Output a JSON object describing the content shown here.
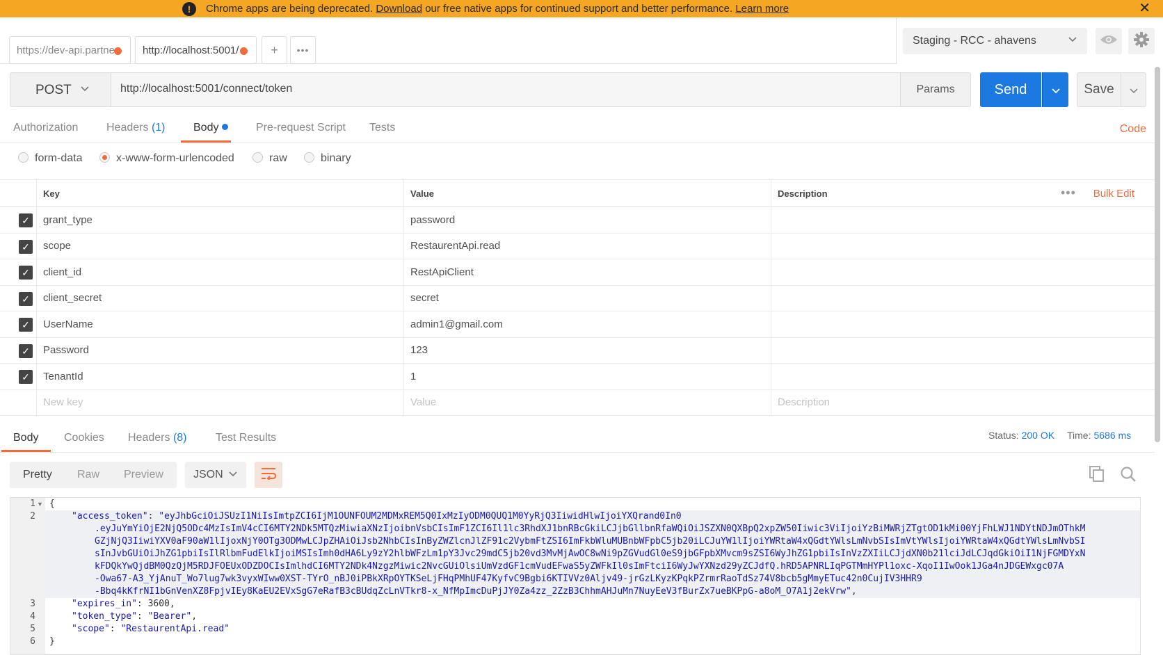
{
  "banner": {
    "message_before": "Chrome apps are being deprecated. ",
    "download_link": "Download",
    "message_middle": " our free native apps for continued support and better performance. ",
    "learn_more_link": "Learn more",
    "close_symbol": "✕"
  },
  "tabs": [
    {
      "label": "https://dev-api.partne",
      "has_unsaved_dot": true
    },
    {
      "label": "http://localhost:5001/",
      "has_unsaved_dot": true
    }
  ],
  "environment": {
    "selected": "Staging - RCC - ahavens"
  },
  "request": {
    "method": "POST",
    "url": "http://localhost:5001/connect/token",
    "params_label": "Params",
    "send_label": "Send",
    "save_label": "Save"
  },
  "request_tabs": {
    "authorization": "Authorization",
    "headers": "Headers",
    "headers_count": "(1)",
    "body": "Body",
    "pre_request": "Pre-request Script",
    "tests": "Tests",
    "code_link": "Code",
    "active": "Body"
  },
  "body_types": {
    "form_data": "form-data",
    "urlencoded": "x-www-form-urlencoded",
    "raw": "raw",
    "binary": "binary",
    "selected": "x-www-form-urlencoded"
  },
  "kv_table": {
    "headers": {
      "key": "Key",
      "value": "Value",
      "description": "Description"
    },
    "bulk_edit": "Bulk Edit",
    "rows": [
      {
        "key": "grant_type",
        "value": "password",
        "checked": true
      },
      {
        "key": "scope",
        "value": "RestaurentApi.read",
        "checked": true
      },
      {
        "key": "client_id",
        "value": "RestApiClient",
        "checked": true
      },
      {
        "key": "client_secret",
        "value": "secret",
        "checked": true
      },
      {
        "key": "UserName",
        "value": "admin1@gmail.com",
        "checked": true
      },
      {
        "key": "Password",
        "value": "123",
        "checked": true
      },
      {
        "key": "TenantId",
        "value": "1",
        "checked": true
      }
    ],
    "new_row": {
      "key_placeholder": "New key",
      "value_placeholder": "Value",
      "description_placeholder": "Description"
    }
  },
  "response": {
    "tabs": {
      "body": "Body",
      "cookies": "Cookies",
      "headers": "Headers",
      "headers_count": "(8)",
      "test_results": "Test Results"
    },
    "status_label": "Status:",
    "status_value": "200 OK",
    "time_label": "Time:",
    "time_value": "5686 ms",
    "views": {
      "pretty": "Pretty",
      "raw": "Raw",
      "preview": "Preview",
      "active": "Pretty"
    },
    "format": "JSON",
    "code_lines": [
      {
        "num": "1",
        "text": "{"
      },
      {
        "num": "2",
        "key": "\"access_token\"",
        "text": "\"eyJhbGciOiJSUzI1NiIsImtpZCI6IjM1OUNFOUM2MDMxREM5Q0IxMzIyODM0QUQ1M0YyRjQ3IiwidHlwIjoiYXQrand0In0"
      },
      {
        "num": "",
        "text": ".eyJuYmYiOjE2NjQ5ODc4MzIsImV4cCI6MTY2NDk5MTQzMiwiaXNzIjoibnVsbCIsImF1ZCI6Il1lc3RhdXJ1bnRBcGkiLCJjbGllbnRfaWQiOiJSZXN0QXBpQ2xpZW50Iiwic3ViIjoiYzBiMWRjZTgtOD1kMi00YjFhLWJ1NDYtNDJmOThkM"
      },
      {
        "num": "",
        "text": "GZjNjQ3IiwiYXV0aF90aW1lIjoxNjY0OTg3ODMwLCJpZHAiOiJsb2NhbCIsInByZWZlcnJlZF91c2VybmFtZSI6ImFkbWluMUBnbWFpbC5jb20iLCJuYW1lIjoiYWRtaW4xQGdtYWlsLmNvbSIsImVtYWlsIjoiYWRtaW4xQGdtYWlsLmNvbSI"
      },
      {
        "num": "",
        "text": "sInJvbGUiOiJhZG1pbiIsIlRlbmFudElkIjoiMSIsImh0dHA6Ly9zY2hlbWFzLm1pY3Jvc29mdC5jb20vd3MvMjAwOC8wNi9pZGVudGl0eS9jbGFpbXMvcm9sZSI6WyJhZG1pbiIsInVzZXIiLCJjdXN0b21lciJdLCJqdGkiOiI1NjFGMDYxN"
      },
      {
        "num": "",
        "text": "kFDQkYwQjdBM0QzQjM5RDJFOEUxODZDOCIsImlhdCI6MTY2NDk4NzgzMiwic2NvcGUiOlsiUmVzdGF1cmVudEFwaS5yZWFkIl0sImFtciI6WyJwYXNzd29yZCJdfQ.hRD5APNRLIqPGTMmHYPl1oxc-XqoI1IwOok1JGa4nJDGEWxgc07A"
      },
      {
        "num": "",
        "text": "-Owa67-A3_YjAnuT_Wo7lug7wk3vyxWIww0XST-TYrO_nBJ0iPBkXRpOYTKSeLjFHqPMhUF47KyfvC9Bgbi6KTIVVz0Aljv49-jrGzLKyzKPqkPZrmrRaoTdSz74V8bcb5gMmyETuc42n0CujIV3HHR9"
      },
      {
        "num": "",
        "text": "-Bbq4kKfrNI1bGnVenXZ8FpjvIEy8KaEU2EVxSgG7eRafB3cBUdqZcLnVTkr8-x_NfMpImcDuPjJY0Za4zz_2ZzB3ChhmAHJuMn7NuyEeV3fBurZx7ueBKPpG-a8oM_O7A1j2ekVrw\""
      },
      {
        "num": "3",
        "key": "\"expires_in\"",
        "text": "3600"
      },
      {
        "num": "4",
        "key": "\"token_type\"",
        "text": "\"Bearer\""
      },
      {
        "num": "5",
        "key": "\"scope\"",
        "text": "\"RestaurentApi.read\""
      },
      {
        "num": "6",
        "text": "}"
      }
    ]
  },
  "icons": [
    "warning-icon",
    "close-icon",
    "eye-icon",
    "gear-icon",
    "chevron-down-icon",
    "copy-icon",
    "search-icon",
    "wrap-lines-icon"
  ],
  "colors": {
    "accent": "#f26b3a",
    "primary": "#1c79e0",
    "banner": "#f5a623"
  }
}
